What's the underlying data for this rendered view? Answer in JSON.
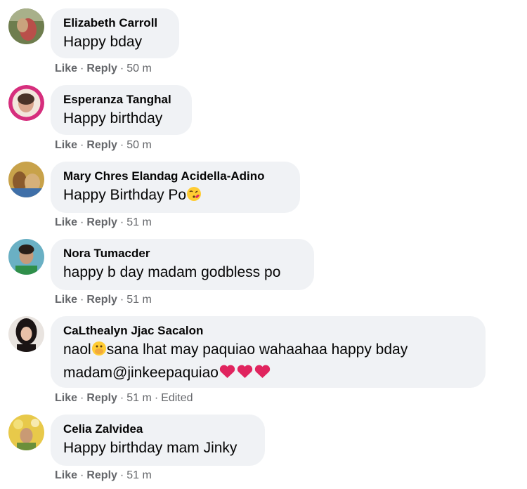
{
  "comments": [
    {
      "author": "Elizabeth Carroll",
      "text": "Happy bday",
      "like": "Like",
      "reply": "Reply",
      "time": "50 m"
    },
    {
      "author": "Esperanza Tanghal",
      "text": "Happy birthday",
      "like": "Like",
      "reply": "Reply",
      "time": "50 m"
    },
    {
      "author": "Mary Chres Elandag Acidella-Adino",
      "text": "Happy Birthday Po",
      "like": "Like",
      "reply": "Reply",
      "time": "51 m"
    },
    {
      "author": "Nora Tumacder",
      "text": "happy b day madam godbless po",
      "like": "Like",
      "reply": "Reply",
      "time": "51 m"
    },
    {
      "author": "CaLthealyn Jjac Sacalon",
      "text_line1_a": "naol",
      "text_line1_b": "sana lhat may paquiao wahaahaa happy bday",
      "text_line2": "madam@jinkeepaquiao",
      "like": "Like",
      "reply": "Reply",
      "time": "51 m",
      "edited": "Edited"
    },
    {
      "author": "Celia Zalvidea",
      "text": "Happy birthday mam Jinky",
      "like": "Like",
      "reply": "Reply",
      "time": "51 m"
    }
  ],
  "colors": {
    "bubble": "#f0f2f5",
    "meta": "#65676b",
    "text": "#050505",
    "heart": "#e0245e"
  },
  "icons": {
    "kiss": "face-blowing-kiss-icon",
    "cover": "face-covering-mouth-icon",
    "heart": "red-heart-icon"
  }
}
